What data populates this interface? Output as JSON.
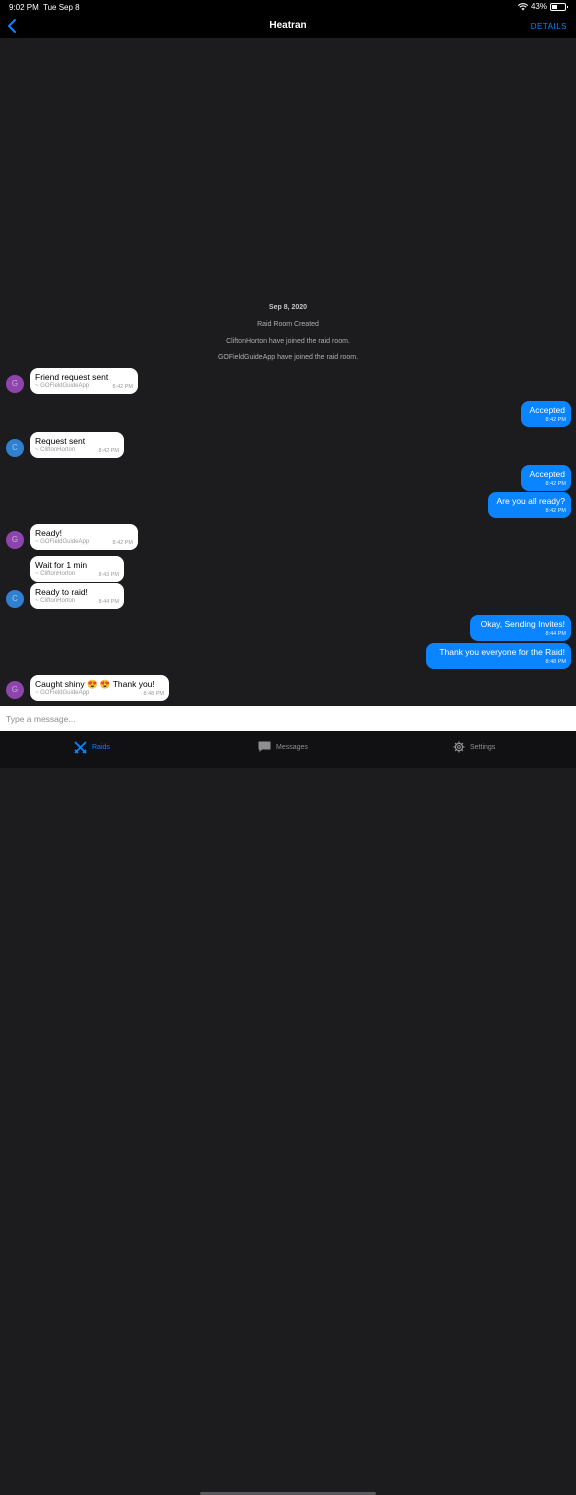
{
  "status_bar": {
    "time": "9:02 PM",
    "date": "Tue Sep 8",
    "battery": "43%"
  },
  "nav": {
    "title": "Heatran",
    "details_label": "DETAILS"
  },
  "chat": {
    "date_header": "Sep 8, 2020",
    "system_messages": [
      "Raid Room Created",
      "CliftonHorton have joined the raid room.",
      "GOFieldGuideApp have joined the raid room."
    ],
    "messages": [
      {
        "text": "Friend request sent",
        "sender": "~ GOFieldGuideApp",
        "time": "8:42 PM",
        "avatar": "G"
      },
      {
        "text": "Accepted",
        "time": "8:42 PM"
      },
      {
        "text": "Request sent",
        "sender": "~ CliftonHorton",
        "time": "8:42 PM",
        "avatar": "C"
      },
      {
        "text": "Accepted",
        "time": "8:42 PM"
      },
      {
        "text": "Are you all ready?",
        "time": "8:42 PM"
      },
      {
        "text": "Ready!",
        "sender": "~ GOFieldGuideApp",
        "time": "8:42 PM",
        "avatar": "G"
      },
      {
        "text": "Wait for 1 min",
        "sender": "~ CliftonHorton",
        "time": "8:43 PM"
      },
      {
        "text": "Ready to raid!",
        "sender": "~ CliftonHorton",
        "time": "8:44 PM",
        "avatar": "C"
      },
      {
        "text": "Okay, Sending Invites!",
        "time": "8:44 PM"
      },
      {
        "text": "Thank you everyone for the Raid!",
        "time": "8:48 PM"
      },
      {
        "text": "Caught shiny 😍 😍  Thank you!",
        "sender": "~ GOFieldGuideApp",
        "time": "8:48 PM",
        "avatar": "G"
      }
    ]
  },
  "input": {
    "placeholder": "Type a message..."
  },
  "tabs": [
    {
      "label": "Raids",
      "icon": "raids-icon",
      "active": true
    },
    {
      "label": "Messages",
      "icon": "messages-icon",
      "active": false
    },
    {
      "label": "Settings",
      "icon": "gear-icon",
      "active": false
    }
  ],
  "colors": {
    "accent": "#0a84ff",
    "avatar_g": "#8e44ad",
    "avatar_c": "#2f80d1"
  }
}
